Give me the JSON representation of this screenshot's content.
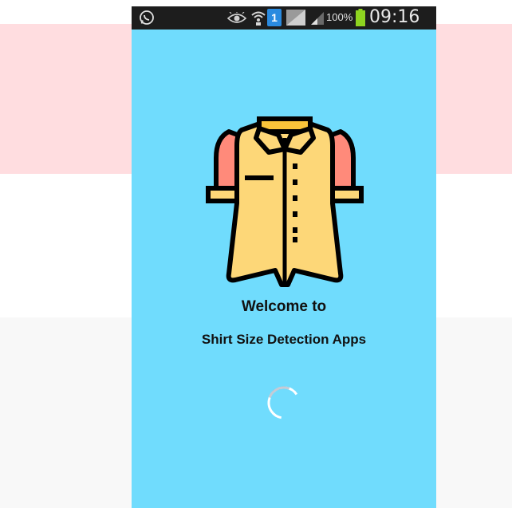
{
  "status_bar": {
    "sim_slot": "1",
    "battery_percent": "100%",
    "time": "09:16",
    "icons": [
      "whatsapp-icon",
      "eye-icon",
      "wifi-icon",
      "sim-icon",
      "no-sim-icon",
      "signal-icon",
      "battery-icon"
    ]
  },
  "splash": {
    "logo_icon": "shirt-icon",
    "welcome_text": "Welcome to",
    "app_name": "Shirt Size Detection Apps",
    "loading_indicator": "spinner-icon"
  },
  "colors": {
    "screen_background": "#70dcfd",
    "status_bar": "#1d1d1d",
    "shirt_body": "#fdd778",
    "shirt_sleeves": "#ff8a7a",
    "collar": "#f9c43a",
    "background_pink": "#ffdde0",
    "background_grey": "#f8f8f8"
  }
}
